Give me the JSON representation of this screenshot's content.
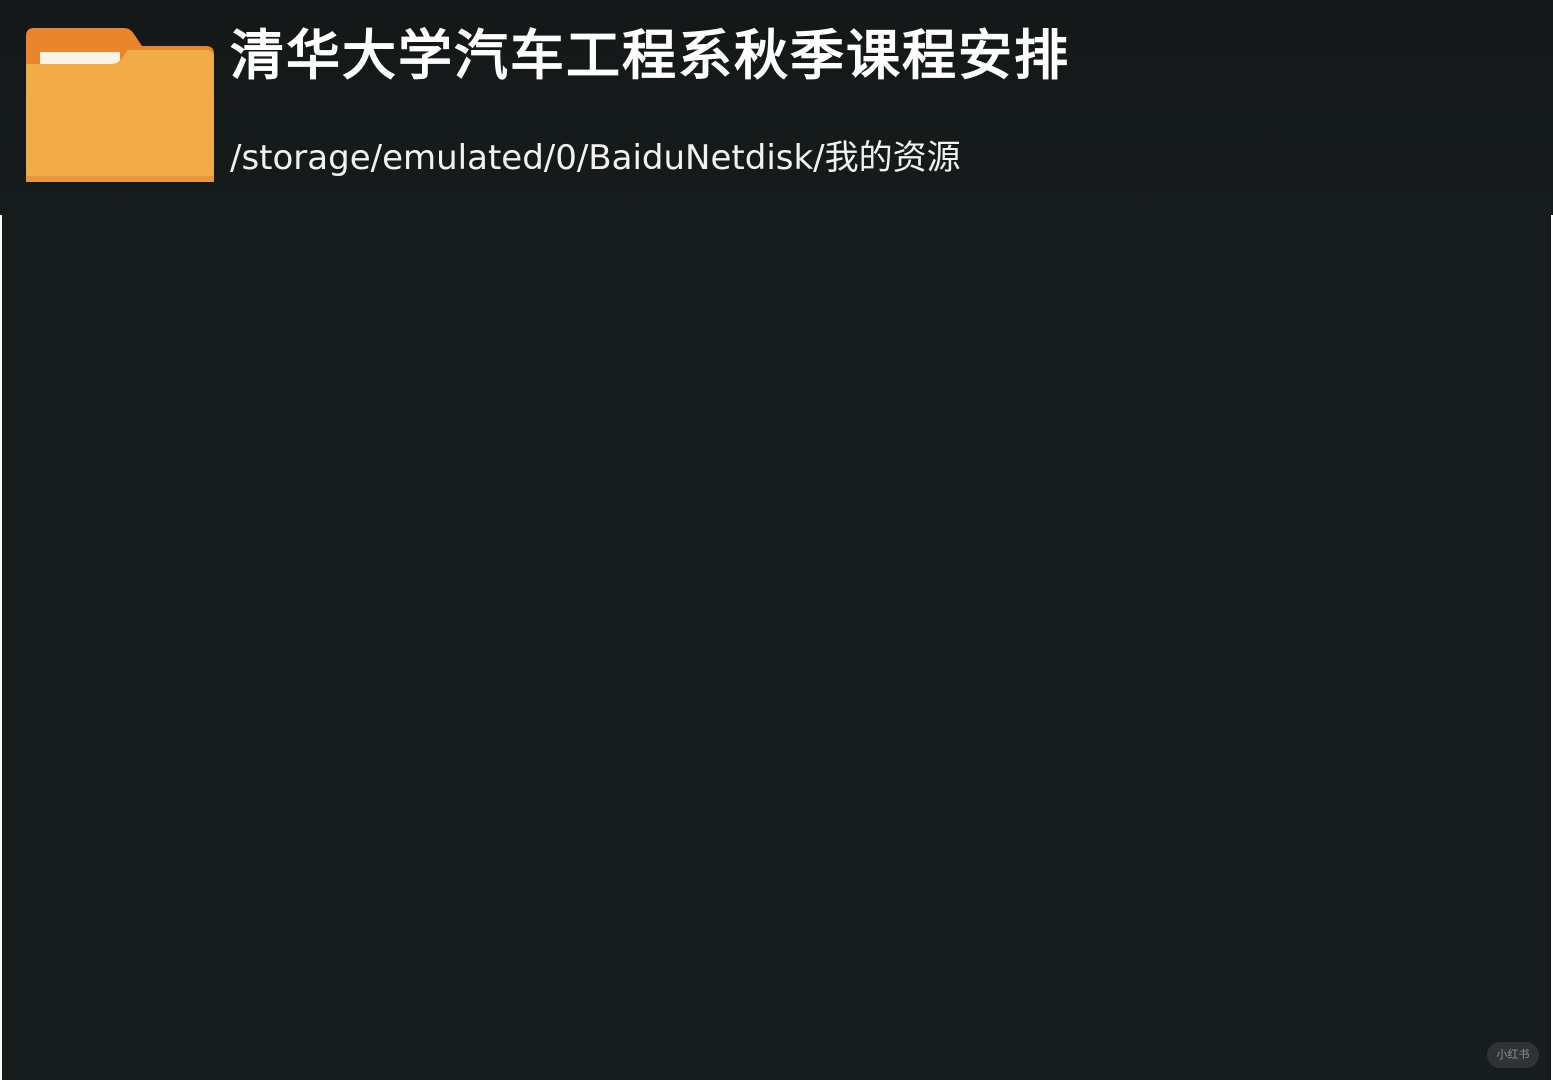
{
  "folder": {
    "icon": "folder-icon",
    "title": "清华大学汽车工程系秋季课程安排",
    "path": "/storage/emulated/0/BaiduNetdisk/我的资源"
  },
  "watermark": {
    "text": "小红书"
  },
  "colors": {
    "background": "#171c1c",
    "folder_body": "#f2ab49",
    "folder_tab": "#e9852c",
    "text": "#ffffff"
  }
}
